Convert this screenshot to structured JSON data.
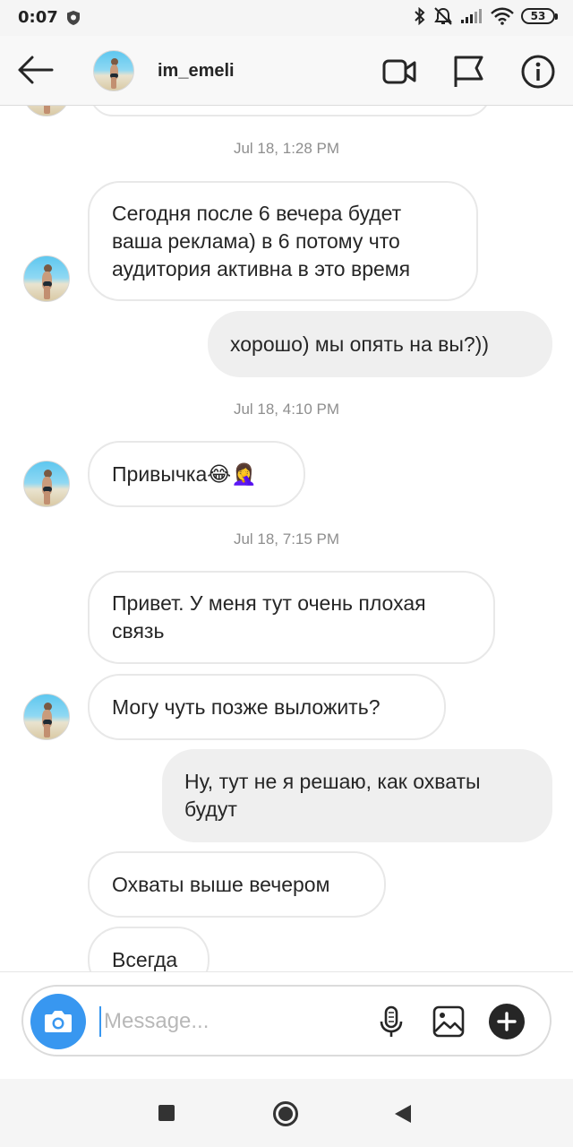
{
  "status_bar": {
    "time": "0:07",
    "battery": "53",
    "icons": [
      "shield-icon",
      "bluetooth-icon",
      "mute-icon",
      "signal-icon",
      "wifi-icon",
      "battery-icon"
    ]
  },
  "header": {
    "username": "im_emeli",
    "icons": [
      "back-arrow-icon",
      "video-call-icon",
      "flag-icon",
      "info-icon"
    ]
  },
  "conversation": {
    "timestamps": [
      "Jul 18, 1:28 PM",
      "Jul 18, 4:10 PM",
      "Jul 18, 7:15 PM"
    ],
    "messages": [
      {
        "side": "in",
        "text": "Сегодня после 6 вечера будет ваша реклама) в 6 потому что аудитория активна в это время"
      },
      {
        "side": "out",
        "text": "хорошо) мы опять на вы?))"
      },
      {
        "side": "in",
        "text": "Привычка😂🤦‍♀️"
      },
      {
        "side": "in",
        "text": "Привет. У меня тут очень плохая связь"
      },
      {
        "side": "in",
        "text": "Могу чуть позже выложить?"
      },
      {
        "side": "out",
        "text": "Ну, тут не я решаю, как охваты будут"
      },
      {
        "side": "in",
        "text": "Охваты выше вечером"
      },
      {
        "side": "in",
        "text": "Всегда"
      }
    ]
  },
  "composer": {
    "placeholder": "Message...",
    "value": "",
    "icons": [
      "camera-icon",
      "microphone-icon",
      "gallery-icon",
      "plus-icon"
    ]
  },
  "nav_bar": {
    "icons": [
      "recents-square-icon",
      "home-circle-icon",
      "back-triangle-icon"
    ]
  },
  "colors": {
    "accent": "#3897f0",
    "incoming_bubble_border": "#e8e8e8",
    "outgoing_bubble": "#efefef",
    "timestamp": "#8e8e8e",
    "header_bg": "#f8f8f8"
  }
}
